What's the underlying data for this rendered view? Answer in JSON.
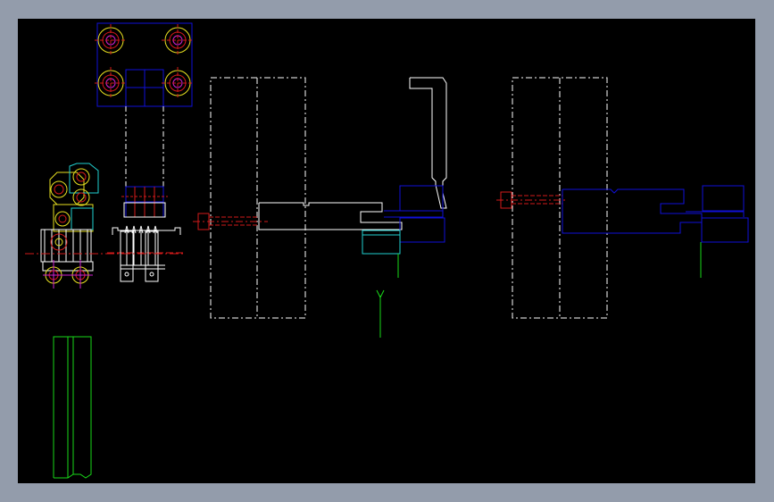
{
  "window": {
    "background_color": "#939cab"
  },
  "drawing": {
    "background_color": "#000000",
    "line_colors": {
      "white": "#ffffff",
      "blue": "#1010d8",
      "red": "#d21a1a",
      "green": "#18d818",
      "cyan": "#20d0d0",
      "yellow": "#e8e020",
      "magenta": "#d020d0"
    }
  }
}
